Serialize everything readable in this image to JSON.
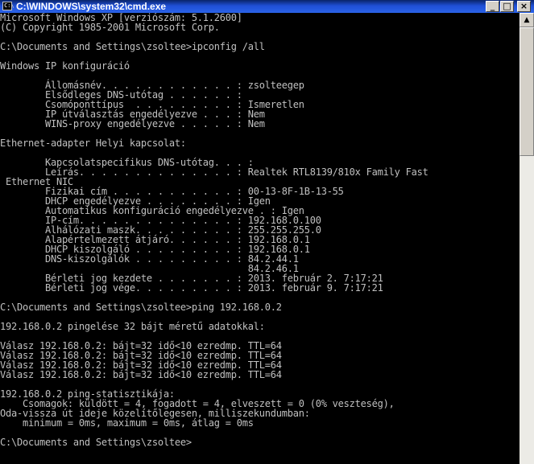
{
  "window": {
    "title": "C:\\WINDOWS\\system32\\cmd.exe",
    "icon_label": "C:\\"
  },
  "title_buttons": {
    "minimize": "_",
    "maximize": "□",
    "close": "×"
  },
  "scrollbar": {
    "up_arrow": "▲"
  },
  "console": {
    "lines": [
      "Microsoft Windows XP [verziószám: 5.1.2600]",
      "(C) Copyright 1985-2001 Microsoft Corp.",
      "",
      "C:\\Documents and Settings\\zsoltee>ipconfig /all",
      "",
      "Windows IP konfiguráció",
      "",
      "        Állomásnév. . . . . . . . . . . . : zsolteegep",
      "        Elsődleges DNS-utótag . . . . . . :",
      "        Csomóponttípus  . . . . . . . . . : Ismeretlen",
      "        IP útválasztás engedélyezve . . . : Nem",
      "        WINS-proxy engedélyezve . . . . . : Nem",
      "",
      "Ethernet-adapter Helyi kapcsolat:",
      "",
      "        Kapcsolatspecifikus DNS-utótag. . . :",
      "        Leírás. . . . . . . . . . . . . . : Realtek RTL8139/810x Family Fast",
      " Ethernet NIC",
      "        Fizikai cím . . . . . . . . . . . : 00-13-8F-1B-13-55",
      "        DHCP engedélyezve . . . . . . . . : Igen",
      "        Automatikus konfiguráció engedélyezve . : Igen",
      "        IP-cím. . . . . . . . . . . . . . : 192.168.0.100",
      "        Alhálózati maszk. . . . . . . . . : 255.255.255.0",
      "        Alapértelmezett átjáró. . . . . . : 192.168.0.1",
      "        DHCP kiszolgáló . . . . . . . . . : 192.168.0.1",
      "        DNS-kiszolgálók . . . . . . . . . : 84.2.44.1",
      "                                            84.2.46.1",
      "        Bérleti jog kezdete . . . . . . . : 2013. február 2. 7:17:21",
      "        Bérleti jog vége. . . . . . . . . : 2013. február 9. 7:17:21",
      "",
      "C:\\Documents and Settings\\zsoltee>ping 192.168.0.2",
      "",
      "192.168.0.2 pingelése 32 bájt méretű adatokkal:",
      "",
      "Válasz 192.168.0.2: bájt=32 idő<10 ezredmp. TTL=64",
      "Válasz 192.168.0.2: bájt=32 idő<10 ezredmp. TTL=64",
      "Válasz 192.168.0.2: bájt=32 idő<10 ezredmp. TTL=64",
      "Válasz 192.168.0.2: bájt=32 idő<10 ezredmp. TTL=64",
      "",
      "192.168.0.2 ping-statisztikája:",
      "    Csomagok: küldött = 4, fogadott = 4, elveszett = 0 (0% veszteség),",
      "Oda-vissza út ideje közelítőlegesen, milliszekundumban:",
      "    minimum = 0ms, maximum = 0ms, átlag = 0ms",
      "",
      "C:\\Documents and Settings\\zsoltee>"
    ]
  }
}
